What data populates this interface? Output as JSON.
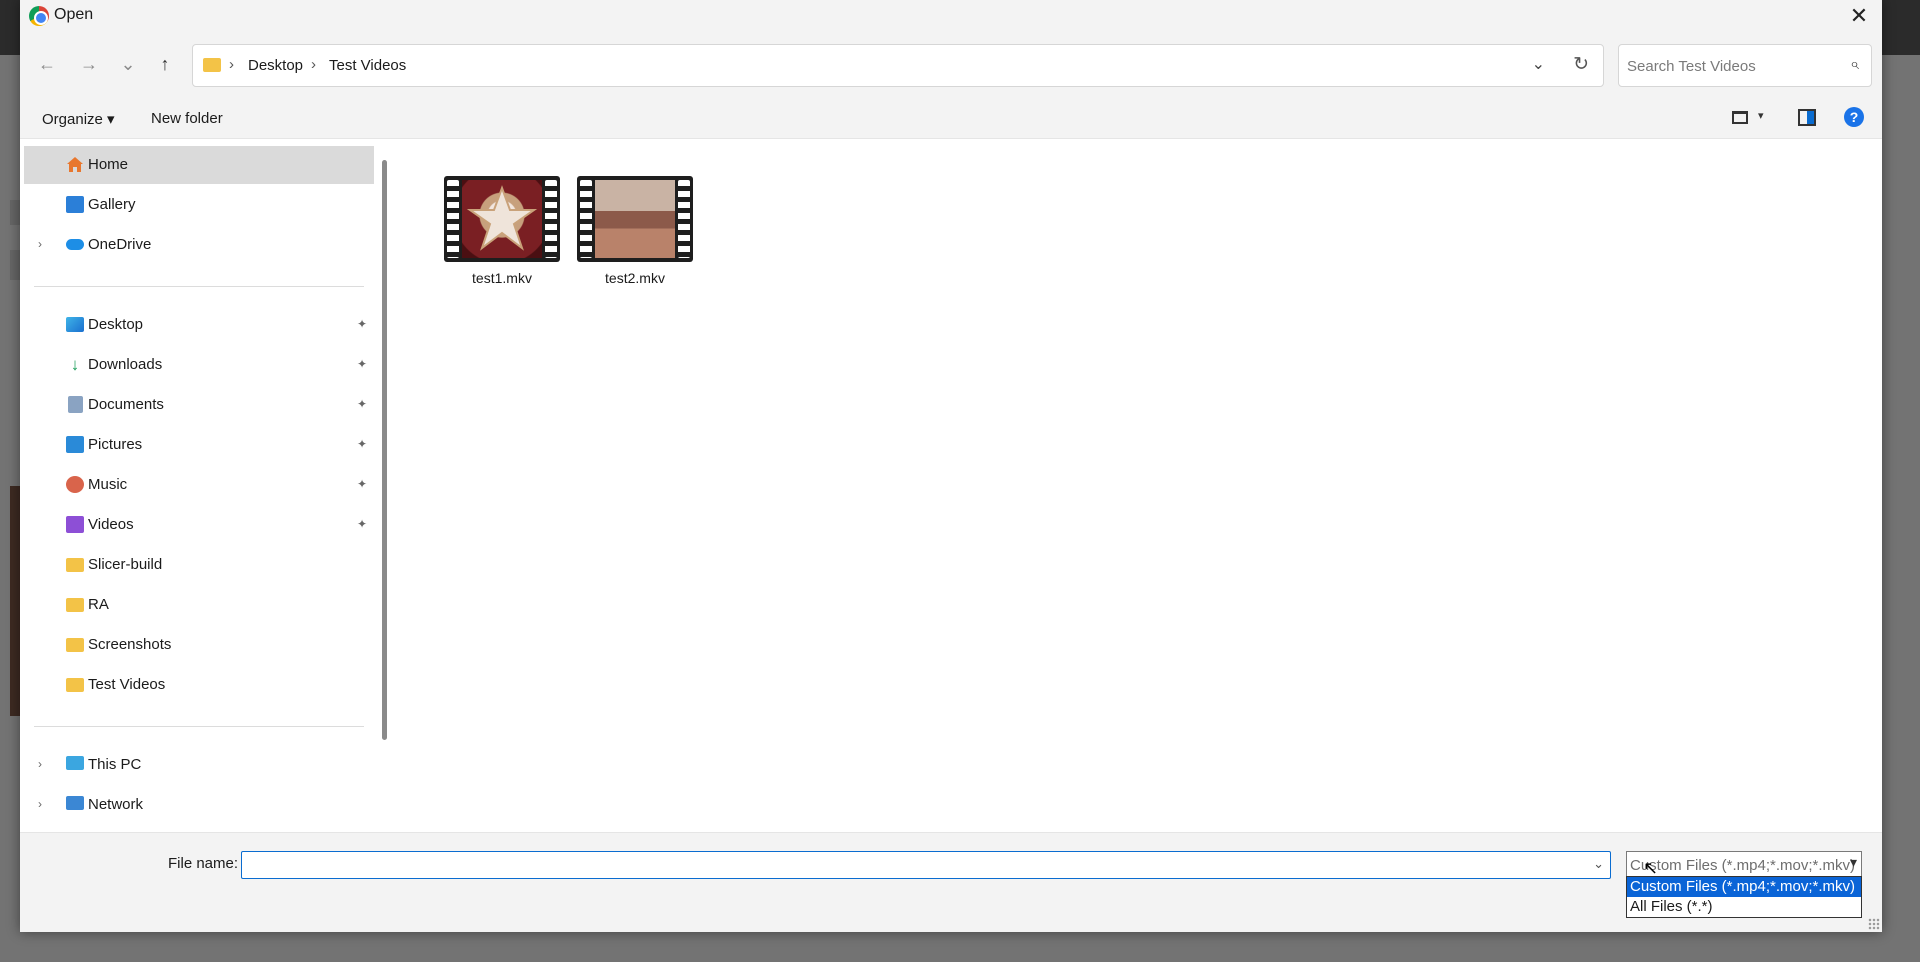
{
  "dialog": {
    "title": "Open",
    "close_glyph": "✕"
  },
  "nav": {
    "back_glyph": "←",
    "forward_glyph": "→",
    "recent_glyph": "⌄",
    "up_glyph": "↑",
    "breadcrumb": [
      "Desktop",
      "Test Videos"
    ],
    "breadcrumb_sep": "›",
    "address_dropdown_glyph": "⌄",
    "refresh_glyph": "↻",
    "search_placeholder": "Search Test Videos",
    "search_glyph": "⌕"
  },
  "commands": {
    "organize_label": "Organize ▾",
    "new_folder_label": "New folder",
    "view_dropdown_glyph": "▾",
    "help_glyph": "?"
  },
  "sidebar": {
    "items": [
      {
        "label": "Home",
        "icon": "home-icon",
        "selected": true
      },
      {
        "label": "Gallery",
        "icon": "gallery-icon"
      },
      {
        "label": "OneDrive",
        "icon": "cloud-icon",
        "expandable": true
      },
      {
        "label": "Desktop",
        "icon": "desktop-icon",
        "pinned": true
      },
      {
        "label": "Downloads",
        "icon": "download-icon",
        "pinned": true
      },
      {
        "label": "Documents",
        "icon": "document-icon",
        "pinned": true
      },
      {
        "label": "Pictures",
        "icon": "pictures-icon",
        "pinned": true
      },
      {
        "label": "Music",
        "icon": "music-icon",
        "pinned": true
      },
      {
        "label": "Videos",
        "icon": "videos-icon",
        "pinned": true
      },
      {
        "label": "Slicer-build",
        "icon": "folder-icon"
      },
      {
        "label": "RA",
        "icon": "folder-icon"
      },
      {
        "label": "Screenshots",
        "icon": "folder-icon"
      },
      {
        "label": "Test Videos",
        "icon": "folder-icon"
      },
      {
        "label": "This PC",
        "icon": "computer-icon",
        "expandable": true
      },
      {
        "label": "Network",
        "icon": "network-icon",
        "expandable": true
      }
    ],
    "expander_glyph": "›",
    "pin_glyph": "✦"
  },
  "files": [
    {
      "name": "test1.mkv"
    },
    {
      "name": "test2.mkv"
    }
  ],
  "bottom": {
    "file_name_label": "File name:",
    "file_name_value": "",
    "file_name_dropdown_glyph": "⌄",
    "file_type_value": "Custom Files (*.mp4;*.mov;*.mkv)",
    "file_type_dropdown_glyph": "▾",
    "file_type_options": [
      "Custom Files (*.mp4;*.mov;*.mkv)",
      "All Files (*.*)"
    ],
    "cursor_glyph": "↖"
  },
  "colors": {
    "accent": "#0a64d7",
    "selected_row": "#dadada",
    "folder": "#f3c347"
  }
}
